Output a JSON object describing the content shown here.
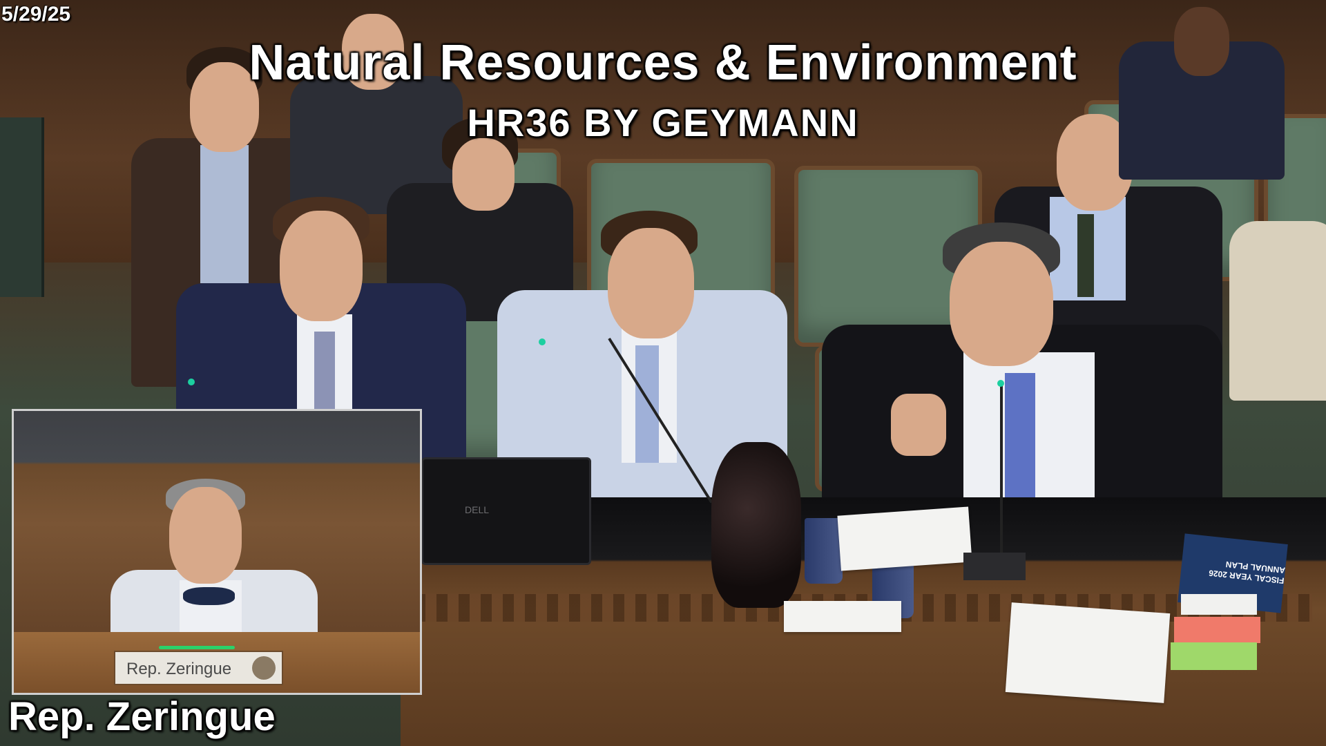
{
  "overlay": {
    "date": "5/29/25",
    "committee_title": "Natural Resources & Environment",
    "bill_title": "HR36 BY GEYMANN",
    "speaker_label": "Rep.  Zeringue"
  },
  "pip": {
    "nameplate": "Rep. Zeringue"
  },
  "scene": {
    "laptop_brand": "DELL",
    "booklet_text": "FISCAL YEAR 2026 ANNUAL PLAN"
  },
  "colors": {
    "overlay_text": "#ffffff",
    "chair_green": "#5f7a66",
    "wood": "#6b4a2e",
    "mic_light": "#1ccfa0",
    "pip_led": "#2bd16a"
  }
}
